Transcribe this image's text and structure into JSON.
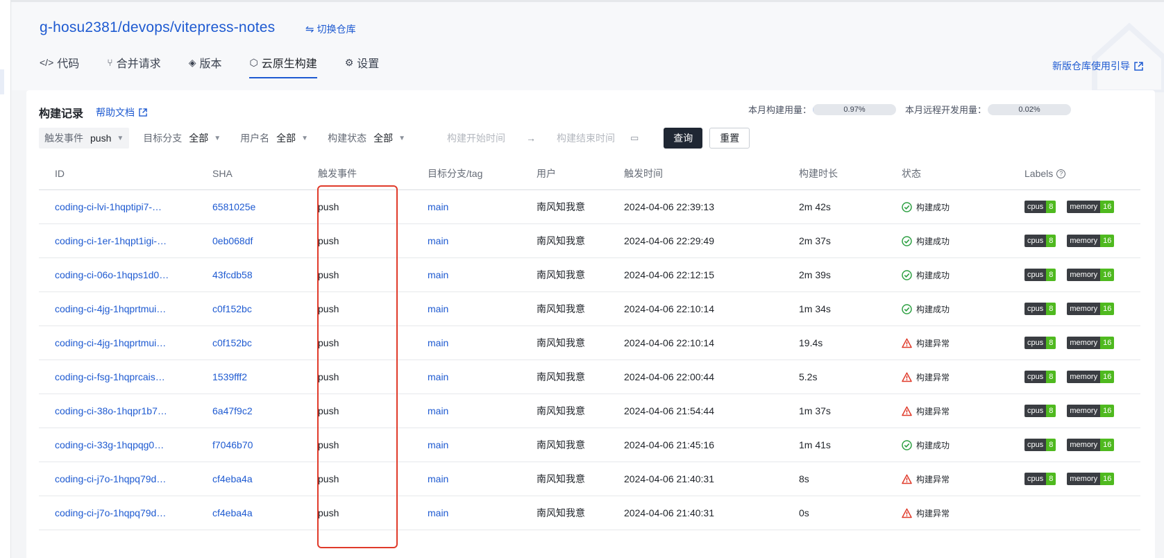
{
  "repo": {
    "title": "g-hosu2381/devops/vitepress-notes",
    "switch_label": "切换仓库",
    "switch_icon": "⇋"
  },
  "tabs": [
    {
      "label": "代码",
      "icon": "code-icon",
      "glyph": "</>"
    },
    {
      "label": "合并请求",
      "icon": "merge-request-icon",
      "glyph": "⑂"
    },
    {
      "label": "版本",
      "icon": "layers-icon",
      "glyph": "◈"
    },
    {
      "label": "云原生构建",
      "icon": "cloud-build-icon",
      "glyph": "⬡"
    },
    {
      "label": "设置",
      "icon": "gear-icon",
      "glyph": "⚙"
    }
  ],
  "guide_link": "新版仓库使用引导",
  "card": {
    "title": "构建记录",
    "help": "帮助文档",
    "usage_build_label": "本月构建用量：",
    "usage_build_pct": "0.97%",
    "usage_build_value": 0.97,
    "usage_remote_label": "本月远程开发用量：",
    "usage_remote_pct": "0.02%",
    "usage_remote_value": 0.02
  },
  "filters": {
    "event_label": "触发事件",
    "event_value": "push",
    "branch_label": "目标分支",
    "branch_value": "全部",
    "user_label": "用户名",
    "user_value": "全部",
    "status_label": "构建状态",
    "status_value": "全部",
    "start_placeholder": "构建开始时间",
    "end_placeholder": "构建结束时间",
    "query": "查询",
    "reset": "重置"
  },
  "table": {
    "headers": {
      "id": "ID",
      "sha": "SHA",
      "event": "触发事件",
      "branch": "目标分支/tag",
      "user": "用户",
      "time": "触发时间",
      "duration": "构建时长",
      "status": "状态",
      "labels": "Labels"
    },
    "rows": [
      {
        "id": "coding-ci-lvi-1hqptipi7-…",
        "sha": "6581025e",
        "event": "push",
        "branch": "main",
        "user": "南风知我意",
        "time": "2024-04-06 22:39:13",
        "duration": "2m 42s",
        "status": "构建成功",
        "ok": true,
        "cpus": "cpus",
        "cpus_v": "8",
        "mem": "memory",
        "mem_v": "16"
      },
      {
        "id": "coding-ci-1er-1hqpt1igi-…",
        "sha": "0eb068df",
        "event": "push",
        "branch": "main",
        "user": "南风知我意",
        "time": "2024-04-06 22:29:49",
        "duration": "2m 37s",
        "status": "构建成功",
        "ok": true,
        "cpus": "cpus",
        "cpus_v": "8",
        "mem": "memory",
        "mem_v": "16"
      },
      {
        "id": "coding-ci-06o-1hqps1d0…",
        "sha": "43fcdb58",
        "event": "push",
        "branch": "main",
        "user": "南风知我意",
        "time": "2024-04-06 22:12:15",
        "duration": "2m 39s",
        "status": "构建成功",
        "ok": true,
        "cpus": "cpus",
        "cpus_v": "8",
        "mem": "memory",
        "mem_v": "16"
      },
      {
        "id": "coding-ci-4jg-1hqprtmui…",
        "sha": "c0f152bc",
        "event": "push",
        "branch": "main",
        "user": "南风知我意",
        "time": "2024-04-06 22:10:14",
        "duration": "1m 34s",
        "status": "构建成功",
        "ok": true,
        "cpus": "cpus",
        "cpus_v": "8",
        "mem": "memory",
        "mem_v": "16"
      },
      {
        "id": "coding-ci-4jg-1hqprtmui…",
        "sha": "c0f152bc",
        "event": "push",
        "branch": "main",
        "user": "南风知我意",
        "time": "2024-04-06 22:10:14",
        "duration": "19.4s",
        "status": "构建异常",
        "ok": false,
        "cpus": "cpus",
        "cpus_v": "8",
        "mem": "memory",
        "mem_v": "16"
      },
      {
        "id": "coding-ci-fsg-1hqprcais…",
        "sha": "1539fff2",
        "event": "push",
        "branch": "main",
        "user": "南风知我意",
        "time": "2024-04-06 22:00:44",
        "duration": "5.2s",
        "status": "构建异常",
        "ok": false,
        "cpus": "cpus",
        "cpus_v": "8",
        "mem": "memory",
        "mem_v": "16"
      },
      {
        "id": "coding-ci-38o-1hqpr1b7…",
        "sha": "6a47f9c2",
        "event": "push",
        "branch": "main",
        "user": "南风知我意",
        "time": "2024-04-06 21:54:44",
        "duration": "1m 37s",
        "status": "构建异常",
        "ok": false,
        "cpus": "cpus",
        "cpus_v": "8",
        "mem": "memory",
        "mem_v": "16"
      },
      {
        "id": "coding-ci-33g-1hqpqg0…",
        "sha": "f7046b70",
        "event": "push",
        "branch": "main",
        "user": "南风知我意",
        "time": "2024-04-06 21:45:16",
        "duration": "1m 41s",
        "status": "构建成功",
        "ok": true,
        "cpus": "cpus",
        "cpus_v": "8",
        "mem": "memory",
        "mem_v": "16"
      },
      {
        "id": "coding-ci-j7o-1hqpq79d…",
        "sha": "cf4eba4a",
        "event": "push",
        "branch": "main",
        "user": "南风知我意",
        "time": "2024-04-06 21:40:31",
        "duration": "8s",
        "status": "构建异常",
        "ok": false,
        "cpus": "cpus",
        "cpus_v": "8",
        "mem": "memory",
        "mem_v": "16"
      },
      {
        "id": "coding-ci-j7o-1hqpq79d…",
        "sha": "cf4eba4a",
        "event": "push",
        "branch": "main",
        "user": "南风知我意",
        "time": "2024-04-06 21:40:31",
        "duration": "0s",
        "status": "构建异常",
        "ok": false,
        "cpus": "",
        "cpus_v": "",
        "mem": "",
        "mem_v": ""
      }
    ]
  },
  "colors": {
    "link": "#1e5ad1",
    "success": "#2ea043",
    "error": "#e03a2a",
    "label_key_bg": "#3a3d42",
    "label_val_bg": "#4fb91f",
    "highlight_box": "#e03a2a"
  }
}
